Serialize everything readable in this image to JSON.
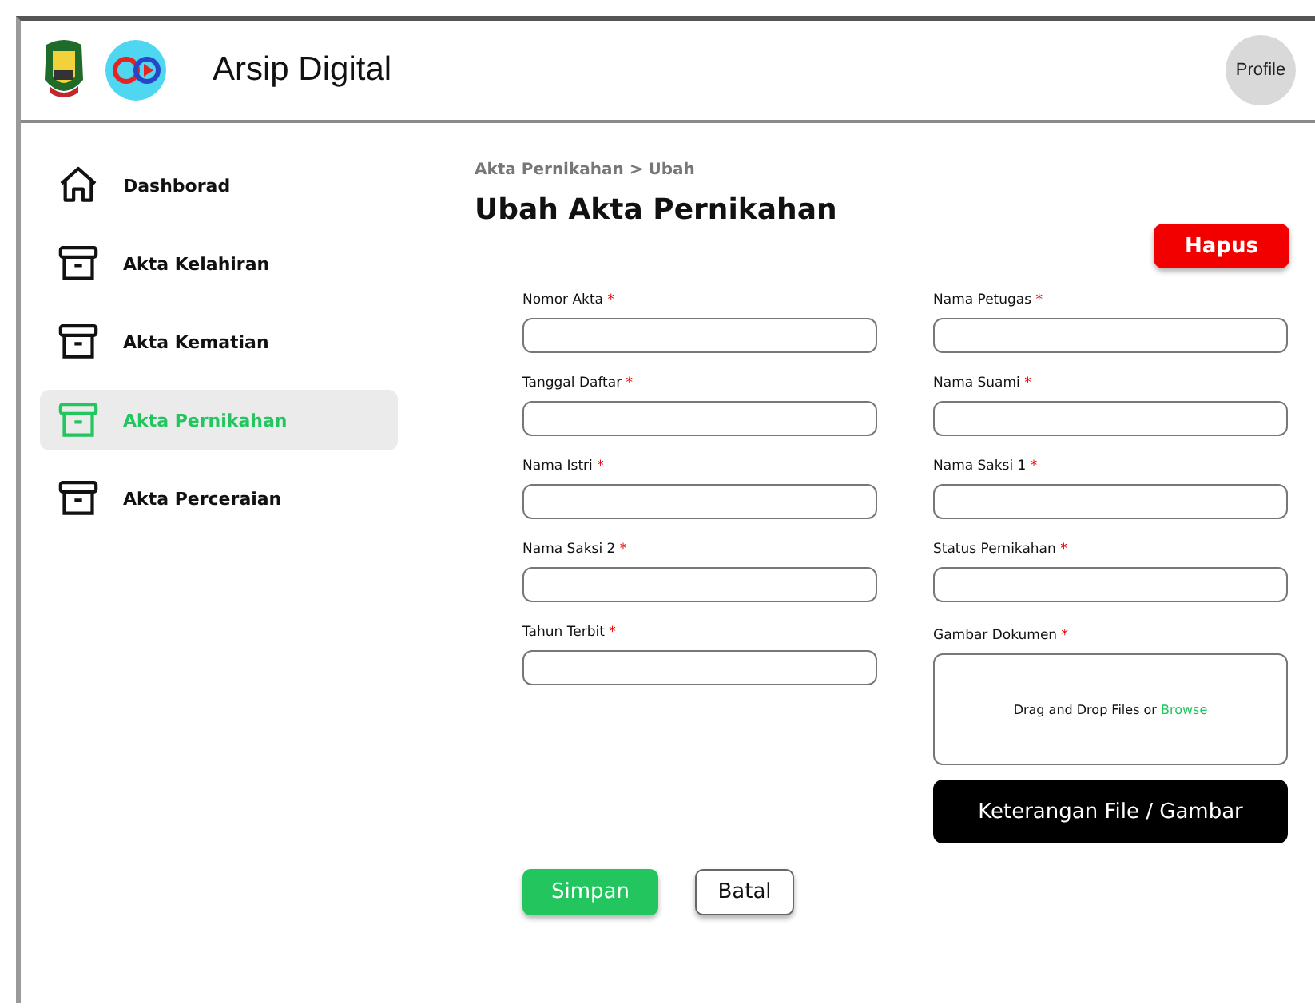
{
  "header": {
    "title": "Arsip Digital",
    "profile": "Profile"
  },
  "sidebar": {
    "items": [
      {
        "label": "Dashborad",
        "kind": "home",
        "selected": false
      },
      {
        "label": "Akta Kelahiran",
        "kind": "archive",
        "selected": false
      },
      {
        "label": "Akta Kematian",
        "kind": "archive",
        "selected": false
      },
      {
        "label": "Akta Pernikahan",
        "kind": "archive",
        "selected": true
      },
      {
        "label": "Akta Perceraian",
        "kind": "archive",
        "selected": false
      }
    ]
  },
  "breadcrumb": "Akta Pernikahan > Ubah",
  "page_title": "Ubah Akta Pernikahan",
  "delete_button": "Hapus",
  "left_fields": [
    {
      "label": "Nomor Akta",
      "mark": "*"
    },
    {
      "label": "Tanggal Daftar",
      "mark": "*"
    },
    {
      "label": "Nama Istri",
      "mark": "*"
    },
    {
      "label": "Nama Saksi 2",
      "mark": "*"
    },
    {
      "label": "Tahun Terbit",
      "mark": "*"
    }
  ],
  "right_fields": [
    {
      "label": "Nama Petugas",
      "mark": "*"
    },
    {
      "label": "Nama Suami",
      "mark": "*"
    },
    {
      "label": "Nama Saksi 1",
      "mark": "*"
    },
    {
      "label": "Status Pernikahan",
      "mark": "*"
    }
  ],
  "upload": {
    "label": "Gambar Dokumen",
    "mark": "*",
    "hint": "Drag and Drop Files or",
    "link": "Browse",
    "button": "Keterangan File / Gambar"
  },
  "actions": {
    "save": "Simpan",
    "cancel": "Batal"
  }
}
